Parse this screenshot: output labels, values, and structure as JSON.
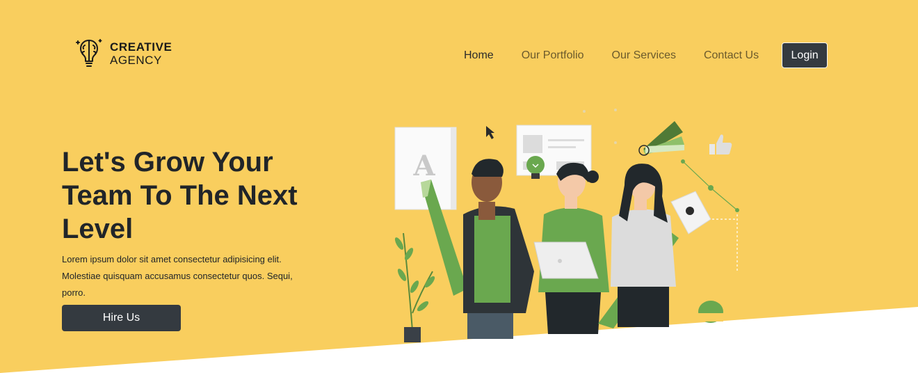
{
  "brand": {
    "line1": "CREATIVE",
    "line2": "AGENCY",
    "logo_icon": "brain-bulb-icon"
  },
  "nav": {
    "items": [
      {
        "label": "Home",
        "active": true
      },
      {
        "label": "Our Portfolio",
        "active": false
      },
      {
        "label": "Our Services",
        "active": false
      },
      {
        "label": "Contact Us",
        "active": false
      }
    ],
    "login_label": "Login"
  },
  "hero": {
    "title": "Let's Grow Your Team To The Next Level",
    "text": "Lorem ipsum dolor sit amet consectetur adipisicing elit. Molestiae quisquam accusamus consectetur quos. Sequi, porro.",
    "cta_label": "Hire Us",
    "illustration_letter": "A"
  },
  "colors": {
    "hero_background": "#f9ce5e",
    "button_dark": "#343a40",
    "illustration_green": "#6aa84f",
    "text_dark": "#212529"
  }
}
